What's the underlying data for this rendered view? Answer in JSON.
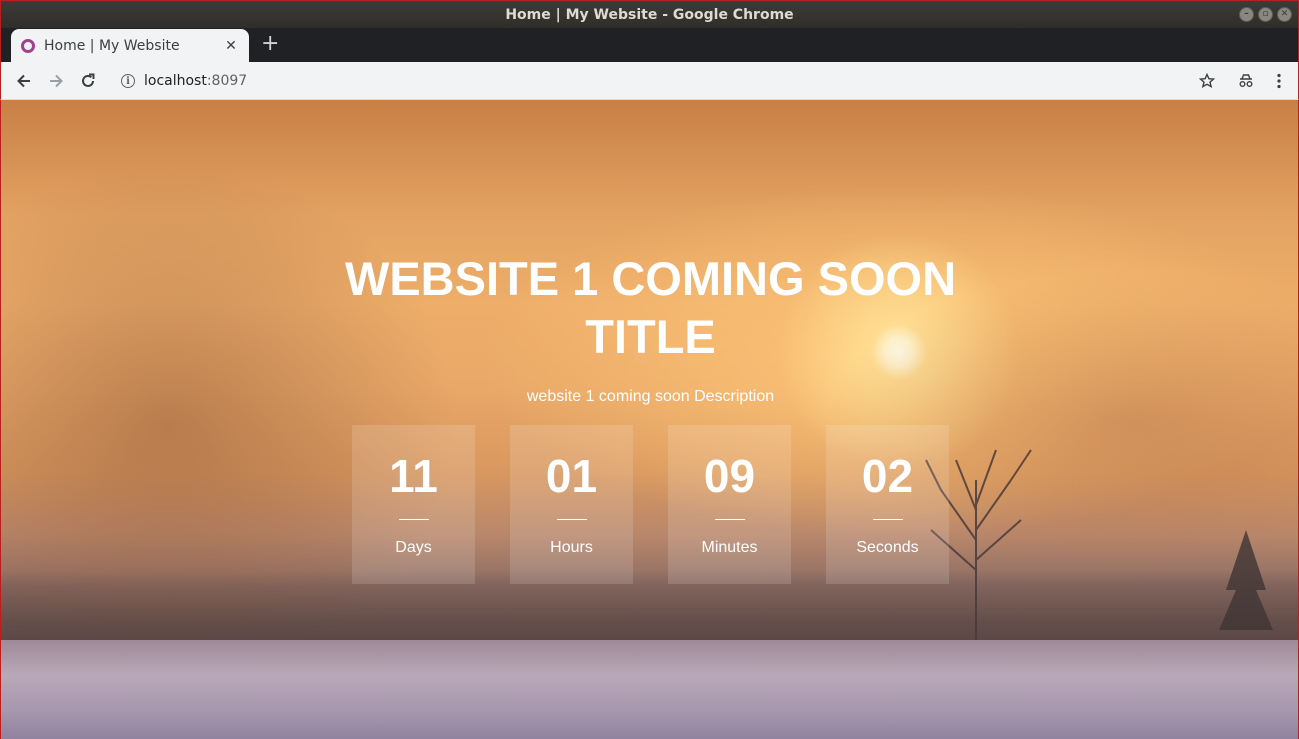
{
  "window": {
    "title": "Home | My Website - Google Chrome"
  },
  "tabs": [
    {
      "label": "Home | My Website",
      "active": true
    }
  ],
  "address_bar": {
    "host": "localhost",
    "port": ":8097"
  },
  "page": {
    "title": "WEBSITE 1 COMING SOON TITLE",
    "description": "website 1 coming soon Description",
    "countdown": [
      {
        "value": "11",
        "label": "Days"
      },
      {
        "value": "01",
        "label": "Hours"
      },
      {
        "value": "09",
        "label": "Minutes"
      },
      {
        "value": "02",
        "label": "Seconds"
      }
    ]
  },
  "icons": {
    "tab_favicon": "ring-icon",
    "back": "arrow-left-icon",
    "forward": "arrow-right-icon",
    "reload": "reload-icon",
    "site_info": "info-icon",
    "bookmark": "star-icon",
    "incognito": "incognito-icon",
    "menu": "kebab-menu-icon"
  },
  "colors": {
    "window_border": "#b82020",
    "favicon": "#a0438f",
    "text_light": "#ffffff"
  }
}
